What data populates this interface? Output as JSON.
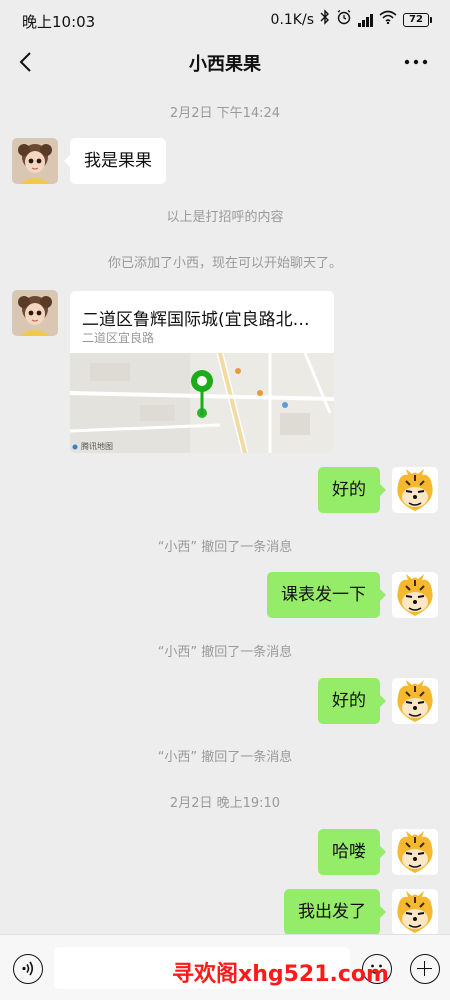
{
  "status_bar": {
    "time": "晚上10:03",
    "speed": "0.1K/s",
    "battery": "72",
    "icons": [
      "bluetooth-icon",
      "alarm-icon",
      "signal-icon",
      "wifi-icon",
      "battery-icon"
    ]
  },
  "header": {
    "title": "小西果果",
    "back_icon": "chevron-left-icon",
    "more_icon": "more-dots-icon"
  },
  "messages": {
    "ts1": "2月2日 下午14:24",
    "greet": "我是果果",
    "sys_greet": "以上是打招呼的内容",
    "sys_added": "你已添加了小西，现在可以开始聊天了。",
    "location_name": "二道区鲁辉国际城(宜良路北…",
    "location_addr": "二道区宜良路",
    "map_provider": "腾讯地图",
    "m1": "好的",
    "recall1": "“小西” 撤回了一条消息",
    "m2": "课表发一下",
    "recall2": "“小西” 撤回了一条消息",
    "m3": "好的",
    "recall3": "“小西” 撤回了一条消息",
    "ts2": "2月2日 晚上19:10",
    "m4": "哈喽",
    "m5": "我出发了"
  },
  "input_bar": {
    "voice_icon": "voice-icon",
    "emoji_icon": "emoji-icon",
    "plus_icon": "plus-icon",
    "watermark": "寻欢阁xhg521.com"
  },
  "colors": {
    "background": "#ededed",
    "sent_bubble": "#95ec69",
    "received_bubble": "#ffffff",
    "system_text": "#9a9a9a",
    "watermark": "#ff1a1a"
  }
}
